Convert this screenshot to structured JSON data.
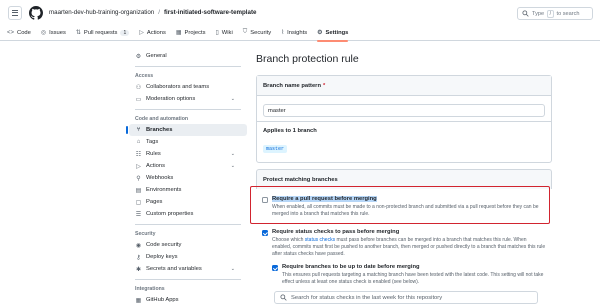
{
  "header": {
    "org": "maarten-dev-hub-training-organization",
    "separator": "/",
    "repo": "first-initiated-software-template",
    "search_placeholder_before": "Type",
    "search_key": "/",
    "search_placeholder_after": "to search"
  },
  "tabs": [
    {
      "label": "Code",
      "icon": "code-icon"
    },
    {
      "label": "Issues",
      "icon": "issue-icon"
    },
    {
      "label": "Pull requests",
      "icon": "pull-request-icon",
      "count": "1"
    },
    {
      "label": "Actions",
      "icon": "play-icon"
    },
    {
      "label": "Projects",
      "icon": "table-icon"
    },
    {
      "label": "Wiki",
      "icon": "book-icon"
    },
    {
      "label": "Security",
      "icon": "shield-icon"
    },
    {
      "label": "Insights",
      "icon": "graph-icon"
    },
    {
      "label": "Settings",
      "icon": "gear-icon",
      "active": true
    }
  ],
  "sidebar": {
    "general": "General",
    "access_group": "Access",
    "collaborators": "Collaborators and teams",
    "moderation": "Moderation options",
    "code_group": "Code and automation",
    "branches": "Branches",
    "tags": "Tags",
    "rules": "Rules",
    "actions": "Actions",
    "webhooks": "Webhooks",
    "environments": "Environments",
    "pages": "Pages",
    "custom_properties": "Custom properties",
    "security_group": "Security",
    "code_security": "Code security",
    "deploy_keys": "Deploy keys",
    "secrets": "Secrets and variables",
    "integrations_group": "Integrations",
    "github_apps": "GitHub Apps"
  },
  "main": {
    "title": "Branch protection rule",
    "pattern_label": "Branch name pattern",
    "pattern_required": "*",
    "pattern_value": "master",
    "applies_label": "Applies to 1 branch",
    "branch_tag": "master",
    "protect_label": "Protect matching branches",
    "rule1_title": "Require a pull request before merging",
    "rule1_desc": "When enabled, all commits must be made to a non-protected branch and submitted via a pull request before they can be merged into a branch that matches this rule.",
    "rule2_title": "Require status checks to pass before merging",
    "rule2_desc_before": "Choose which",
    "rule2_desc_link": "status checks",
    "rule2_desc_after": "must pass before branches can be merged into a branch that matches this rule. When enabled, commits must first be pushed to another branch, then merged or pushed directly to a branch that matches this rule after status checks have passed.",
    "rule3_title": "Require branches to be up to date before merging",
    "rule3_desc": "This ensures pull requests targeting a matching branch have been tested with the latest code. This setting will not take effect unless at least one status check is enabled (see below).",
    "status_search_placeholder": "Search for status checks in the last week for this repository"
  },
  "colors": {
    "accent": "#0969da",
    "active_tab_underline": "#fd8c73",
    "highlight_box": "#d1242f"
  }
}
